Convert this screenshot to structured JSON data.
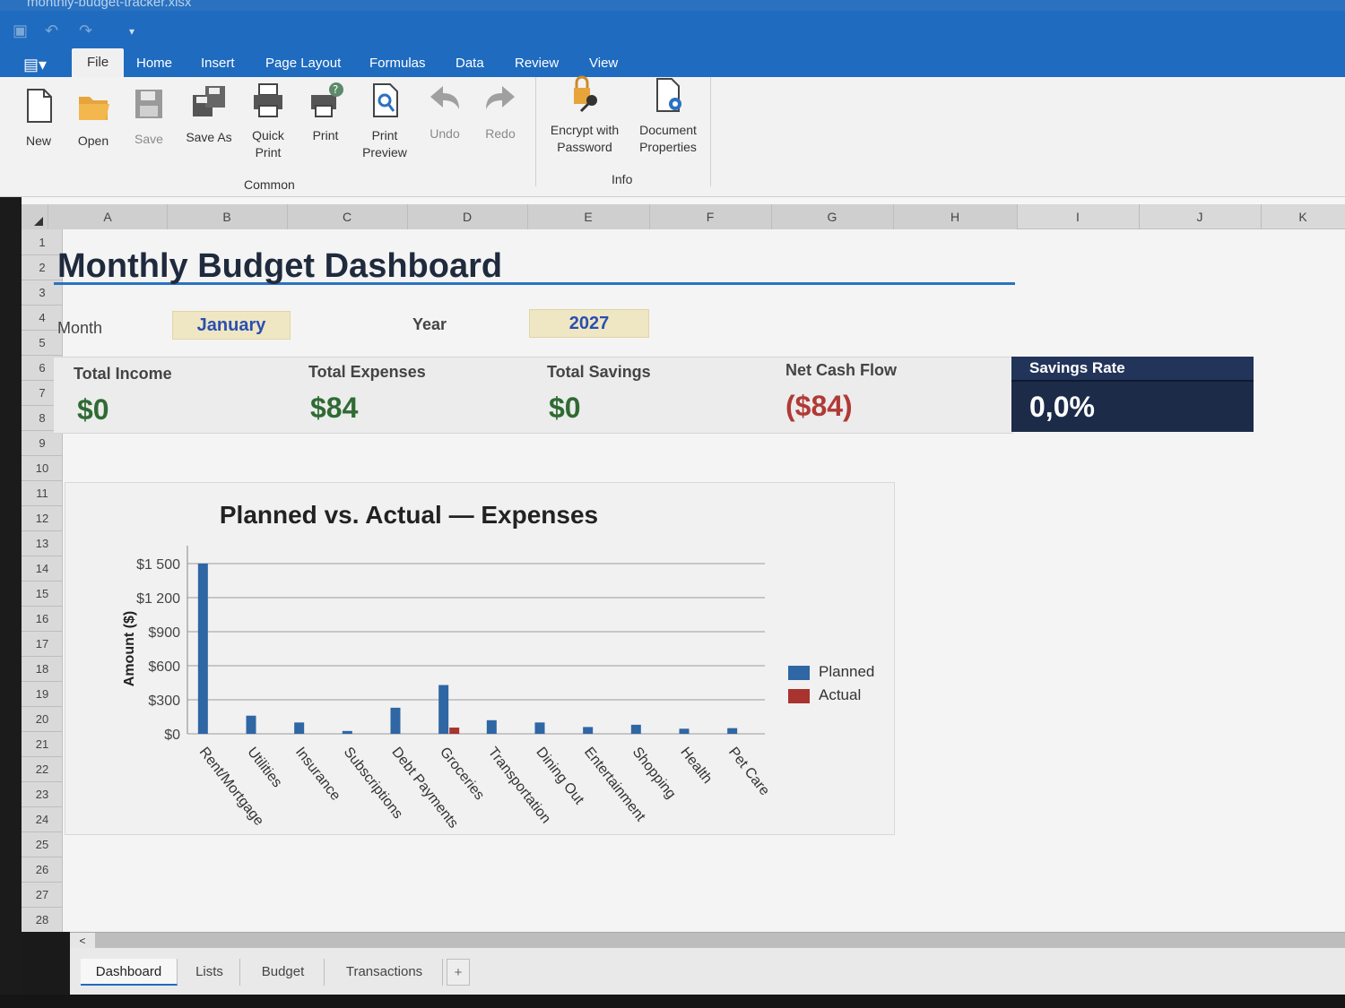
{
  "window": {
    "title": "monthly-budget-tracker.xlsx"
  },
  "ribbon_tabs": [
    "File",
    "Home",
    "Insert",
    "Page Layout",
    "Formulas",
    "Data",
    "Review",
    "View"
  ],
  "ribbon": {
    "common": {
      "label": "Common",
      "buttons": [
        {
          "label": "New",
          "icon": "new-document-icon"
        },
        {
          "label": "Open",
          "icon": "open-folder-icon"
        },
        {
          "label": "Save",
          "icon": "save-icon"
        },
        {
          "label": "Save As",
          "icon": "save-as-icon"
        },
        {
          "label": "Quick Print",
          "icon": "quick-print-icon"
        },
        {
          "label": "Print",
          "icon": "print-icon"
        },
        {
          "label": "Print Preview",
          "icon": "print-preview-icon"
        },
        {
          "label": "Undo",
          "icon": "undo-icon"
        },
        {
          "label": "Redo",
          "icon": "redo-icon"
        }
      ]
    },
    "info": {
      "label": "Info",
      "buttons": [
        {
          "label": "Encrypt with Password",
          "icon": "lock-key-icon"
        },
        {
          "label": "Document Properties",
          "icon": "document-properties-icon"
        }
      ]
    }
  },
  "columns": [
    "A",
    "B",
    "C",
    "D",
    "E",
    "F",
    "G",
    "H",
    "I",
    "J",
    "K"
  ],
  "rows": [
    "1",
    "2",
    "3",
    "4",
    "5",
    "6",
    "7",
    "8",
    "9",
    "10",
    "11",
    "12",
    "13",
    "14",
    "15",
    "16",
    "17",
    "18",
    "19",
    "20",
    "21",
    "22",
    "23",
    "24",
    "25",
    "26",
    "27",
    "28"
  ],
  "dashboard": {
    "title": "Monthly Budget Dashboard",
    "month_label": "Month",
    "month_value": "January",
    "year_label": "Year",
    "year_value": "2027",
    "kpis": [
      {
        "label": "Total Income",
        "value": "$0",
        "color": "#2f6b33"
      },
      {
        "label": "Total Expenses",
        "value": "$84",
        "color": "#2f6b33"
      },
      {
        "label": "Total Savings",
        "value": "$0",
        "color": "#2f6b33"
      },
      {
        "label": "Net Cash Flow",
        "value": "($84)",
        "color": "#b03a35"
      }
    ],
    "savings_rate": {
      "label": "Savings Rate",
      "value": "0,0%"
    }
  },
  "chart_data": {
    "type": "bar",
    "title": "Planned vs. Actual — Expenses",
    "ylabel": "Amount ($)",
    "xlabel": "",
    "ylim": [
      0,
      1500
    ],
    "yticks": [
      0,
      300,
      600,
      900,
      1200,
      1500
    ],
    "ytick_labels": [
      "$0",
      "$300",
      "$600",
      "$900",
      "$1 200",
      "$1 500"
    ],
    "categories": [
      "Rent/Mortgage",
      "Utilities",
      "Insurance",
      "Subscriptions",
      "Debt Payments",
      "Groceries",
      "Transportation",
      "Dining Out",
      "Entertainment",
      "Shopping",
      "Health",
      "Pet Care"
    ],
    "series": [
      {
        "name": "Planned",
        "color": "#2f66a4",
        "values": [
          1500,
          160,
          100,
          25,
          230,
          430,
          120,
          100,
          60,
          80,
          45,
          50
        ]
      },
      {
        "name": "Actual",
        "color": "#a8332f",
        "values": [
          0,
          0,
          0,
          0,
          0,
          55,
          0,
          0,
          0,
          0,
          0,
          0
        ]
      }
    ],
    "legend_position": "right",
    "grid": true
  },
  "sheet_tabs": [
    "Dashboard",
    "Lists",
    "Budget",
    "Transactions",
    "+"
  ]
}
